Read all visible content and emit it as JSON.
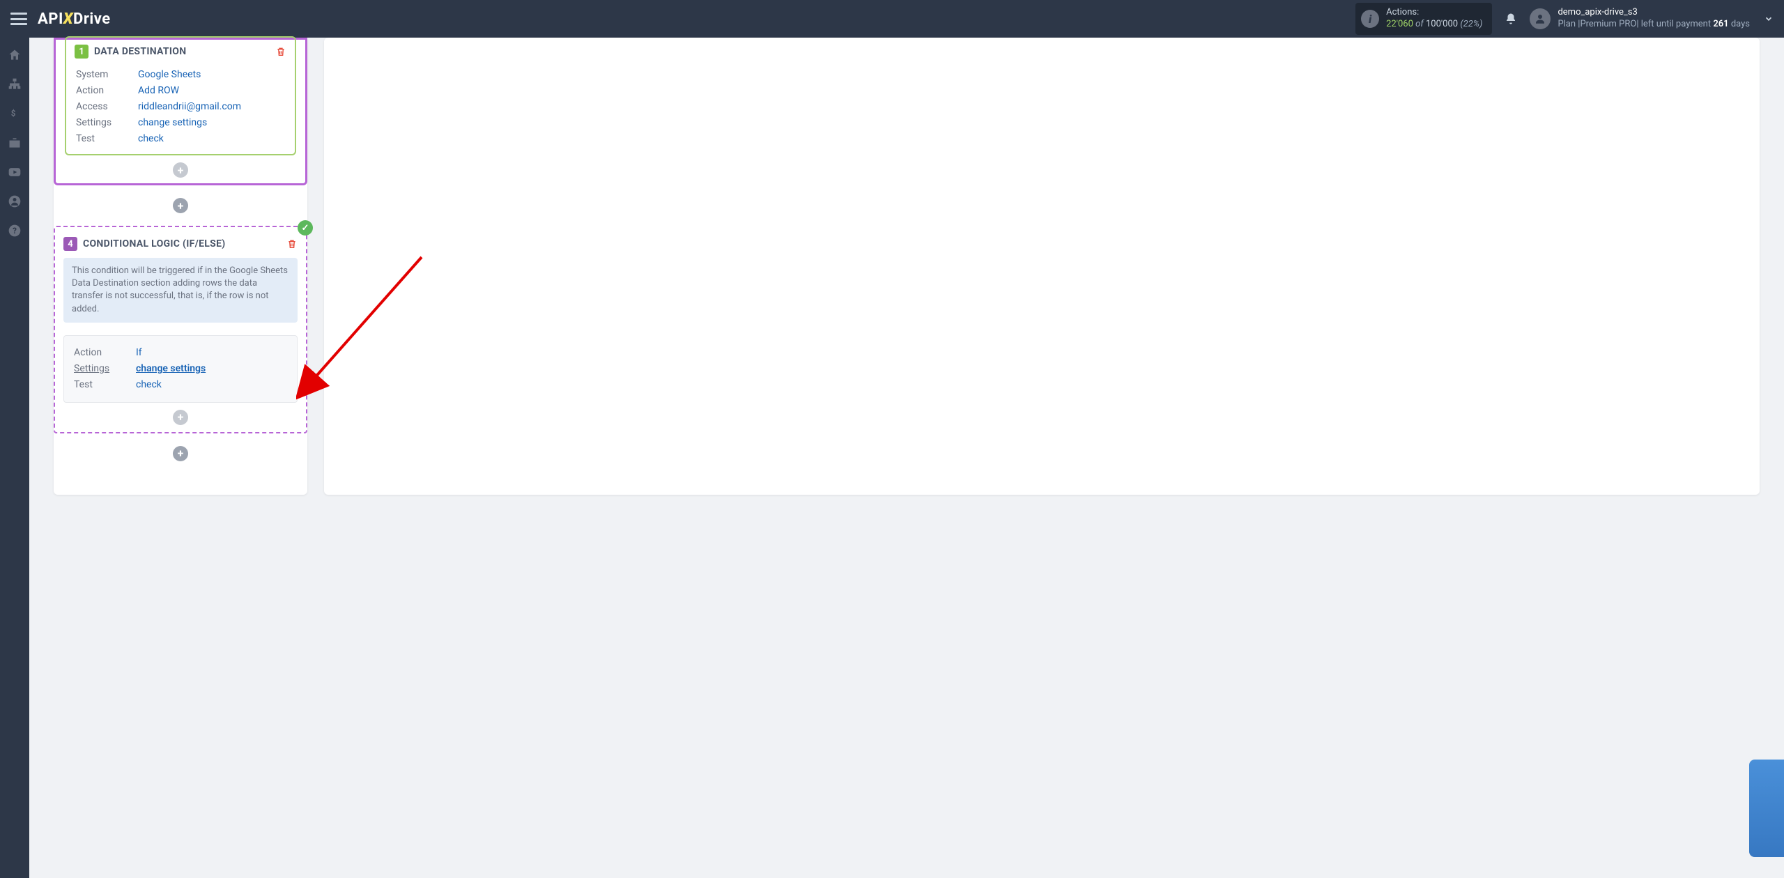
{
  "header": {
    "logo_api": "API",
    "logo_x": "X",
    "logo_drive": "Drive",
    "actions_label": "Actions:",
    "actions_used": "22'060",
    "actions_of": "of",
    "actions_total": "100'000",
    "actions_pct": "(22%)",
    "user_name": "demo_apix-drive_s3",
    "plan_prefix": "Plan |Premium PRO| left until payment ",
    "plan_days": "261",
    "plan_suffix": " days"
  },
  "block1": {
    "number": "1",
    "title": "DATA DESTINATION",
    "rows": [
      {
        "label": "System",
        "value": "Google Sheets"
      },
      {
        "label": "Action",
        "value": "Add ROW"
      },
      {
        "label": "Access",
        "value": "riddleandrii@gmail.com"
      },
      {
        "label": "Settings",
        "value": "change settings"
      },
      {
        "label": "Test",
        "value": "check"
      }
    ]
  },
  "block2": {
    "number": "4",
    "title": "CONDITIONAL LOGIC (IF/ELSE)",
    "info": "This condition will be triggered if in the Google Sheets Data Destination section adding rows the data transfer is not successful, that is, if the row is not added.",
    "rows": [
      {
        "label": "Action",
        "value": "If"
      },
      {
        "label": "Settings",
        "value": "change settings"
      },
      {
        "label": "Test",
        "value": "check"
      }
    ]
  },
  "plus": "+"
}
